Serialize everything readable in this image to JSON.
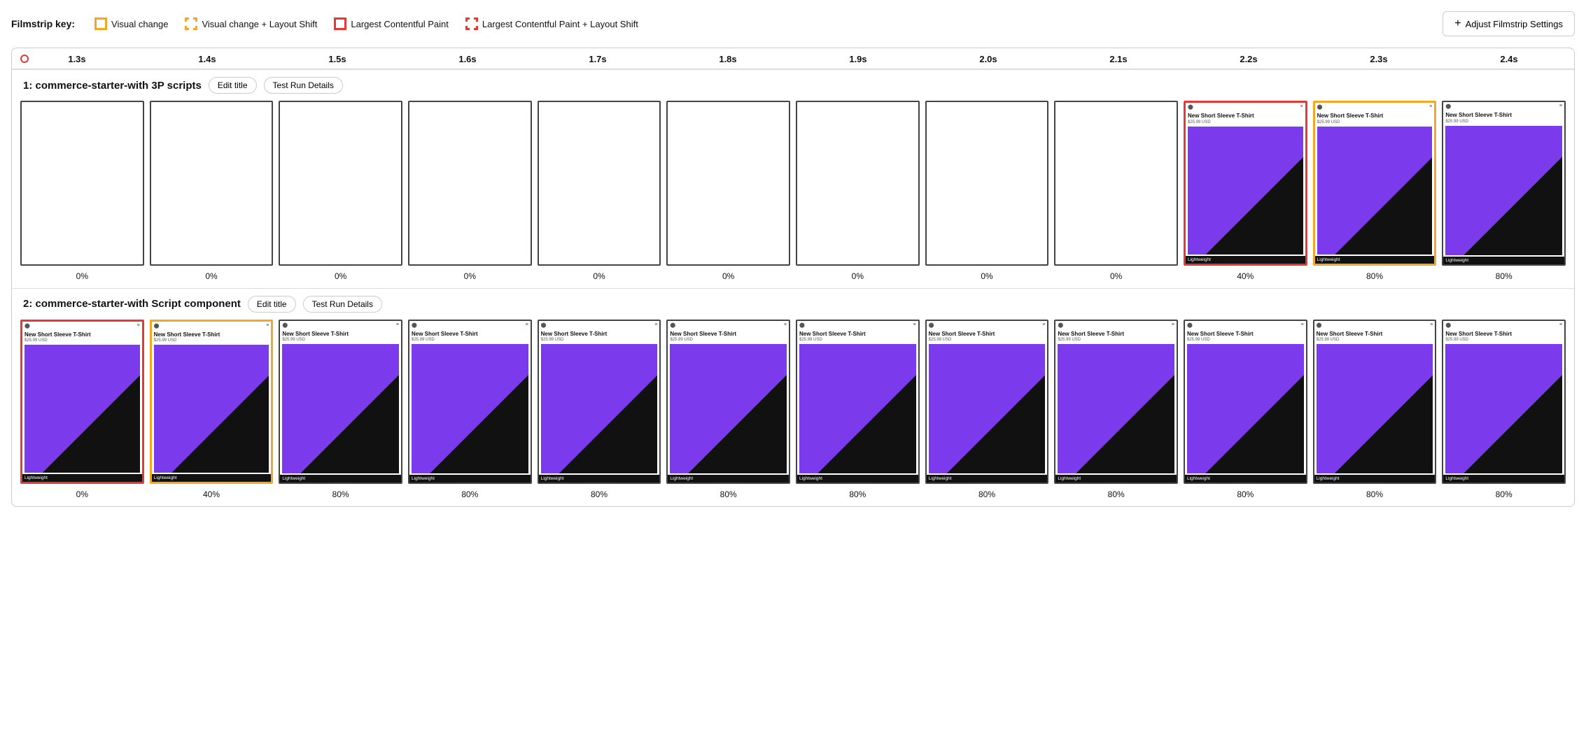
{
  "legend": {
    "label": "Filmstrip key:",
    "items": [
      {
        "id": "visual-change",
        "type": "solid-yellow",
        "text": "Visual change"
      },
      {
        "id": "visual-change-layout-shift",
        "type": "dashed-yellow",
        "text": "Visual change + Layout Shift"
      },
      {
        "id": "lcp",
        "type": "solid-red",
        "text": "Largest Contentful Paint"
      },
      {
        "id": "lcp-layout-shift",
        "type": "dashed-red",
        "text": "Largest Contentful Paint + Layout Shift"
      }
    ],
    "adjust_btn": "Adjust Filmstrip Settings"
  },
  "timeline": {
    "ticks": [
      "1.3s",
      "1.4s",
      "1.5s",
      "1.6s",
      "1.7s",
      "1.8s",
      "1.9s",
      "2.0s",
      "2.1s",
      "2.2s",
      "2.3s",
      "2.4s"
    ]
  },
  "sections": [
    {
      "id": "section-1",
      "title": "1: commerce-starter-with 3P scripts",
      "edit_btn": "Edit title",
      "details_btn": "Test Run Details",
      "frames": [
        {
          "id": "f1-1",
          "border": "plain",
          "empty": true,
          "pct": "0%"
        },
        {
          "id": "f1-2",
          "border": "plain",
          "empty": true,
          "pct": "0%"
        },
        {
          "id": "f1-3",
          "border": "plain",
          "empty": true,
          "pct": "0%"
        },
        {
          "id": "f1-4",
          "border": "plain",
          "empty": true,
          "pct": "0%"
        },
        {
          "id": "f1-5",
          "border": "plain",
          "empty": true,
          "pct": "0%"
        },
        {
          "id": "f1-6",
          "border": "plain",
          "empty": true,
          "pct": "0%"
        },
        {
          "id": "f1-7",
          "border": "plain",
          "empty": true,
          "pct": "0%"
        },
        {
          "id": "f1-8",
          "border": "plain",
          "empty": true,
          "pct": "0%"
        },
        {
          "id": "f1-9",
          "border": "plain",
          "empty": true,
          "pct": "0%"
        },
        {
          "id": "f1-10",
          "border": "solid-red",
          "empty": false,
          "pct": "40%"
        },
        {
          "id": "f1-11",
          "border": "solid-yellow",
          "empty": false,
          "pct": "80%"
        },
        {
          "id": "f1-12",
          "border": "plain",
          "empty": false,
          "pct": "80%"
        }
      ]
    },
    {
      "id": "section-2",
      "title": "2: commerce-starter-with Script component",
      "edit_btn": "Edit title",
      "details_btn": "Test Run Details",
      "frames": [
        {
          "id": "f2-1",
          "border": "solid-red",
          "empty": false,
          "pct": "0%"
        },
        {
          "id": "f2-2",
          "border": "solid-yellow",
          "empty": false,
          "pct": "40%"
        },
        {
          "id": "f2-3",
          "border": "plain",
          "empty": false,
          "pct": "80%"
        },
        {
          "id": "f2-4",
          "border": "plain",
          "empty": false,
          "pct": "80%"
        },
        {
          "id": "f2-5",
          "border": "plain",
          "empty": false,
          "pct": "80%"
        },
        {
          "id": "f2-6",
          "border": "plain",
          "empty": false,
          "pct": "80%"
        },
        {
          "id": "f2-7",
          "border": "plain",
          "empty": false,
          "pct": "80%"
        },
        {
          "id": "f2-8",
          "border": "plain",
          "empty": false,
          "pct": "80%"
        },
        {
          "id": "f2-9",
          "border": "plain",
          "empty": false,
          "pct": "80%"
        },
        {
          "id": "f2-10",
          "border": "plain",
          "empty": false,
          "pct": "80%"
        },
        {
          "id": "f2-11",
          "border": "plain",
          "empty": false,
          "pct": "80%"
        },
        {
          "id": "f2-12",
          "border": "plain",
          "empty": false,
          "pct": "80%"
        }
      ]
    }
  ],
  "product": {
    "title": "New Short Sleeve T-Shirt",
    "price": "$25.99 USD",
    "footer": "Lightweight"
  }
}
